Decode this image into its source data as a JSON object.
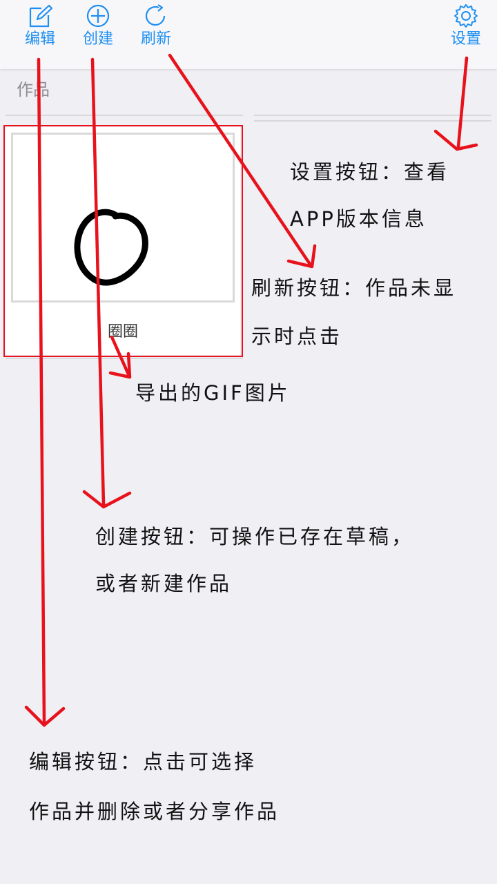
{
  "toolbar": {
    "edit_label": "编辑",
    "create_label": "创建",
    "refresh_label": "刷新",
    "settings_label": "设置"
  },
  "section": {
    "title": "作品"
  },
  "work": {
    "name": "圈圈"
  },
  "annotations": {
    "settings_line1": "设置按钮：查看",
    "settings_line2": "APP版本信息",
    "refresh_line1": "刷新按钮：作品未显",
    "refresh_line2": "示时点击",
    "gif": "导出的GIF图片",
    "create_line1": "创建按钮：可操作已存在草稿，",
    "create_line2": "或者新建作品",
    "edit_line1": "编辑按钮：点击可选择",
    "edit_line2": "作品并删除或者分享作品"
  },
  "colors": {
    "accent": "#1e8ff2",
    "annotation_red": "#e8121c",
    "background": "#efeff4"
  },
  "icons": {
    "edit": "pencil-square-icon",
    "create": "plus-circle-icon",
    "refresh": "refresh-icon",
    "settings": "gear-icon"
  }
}
